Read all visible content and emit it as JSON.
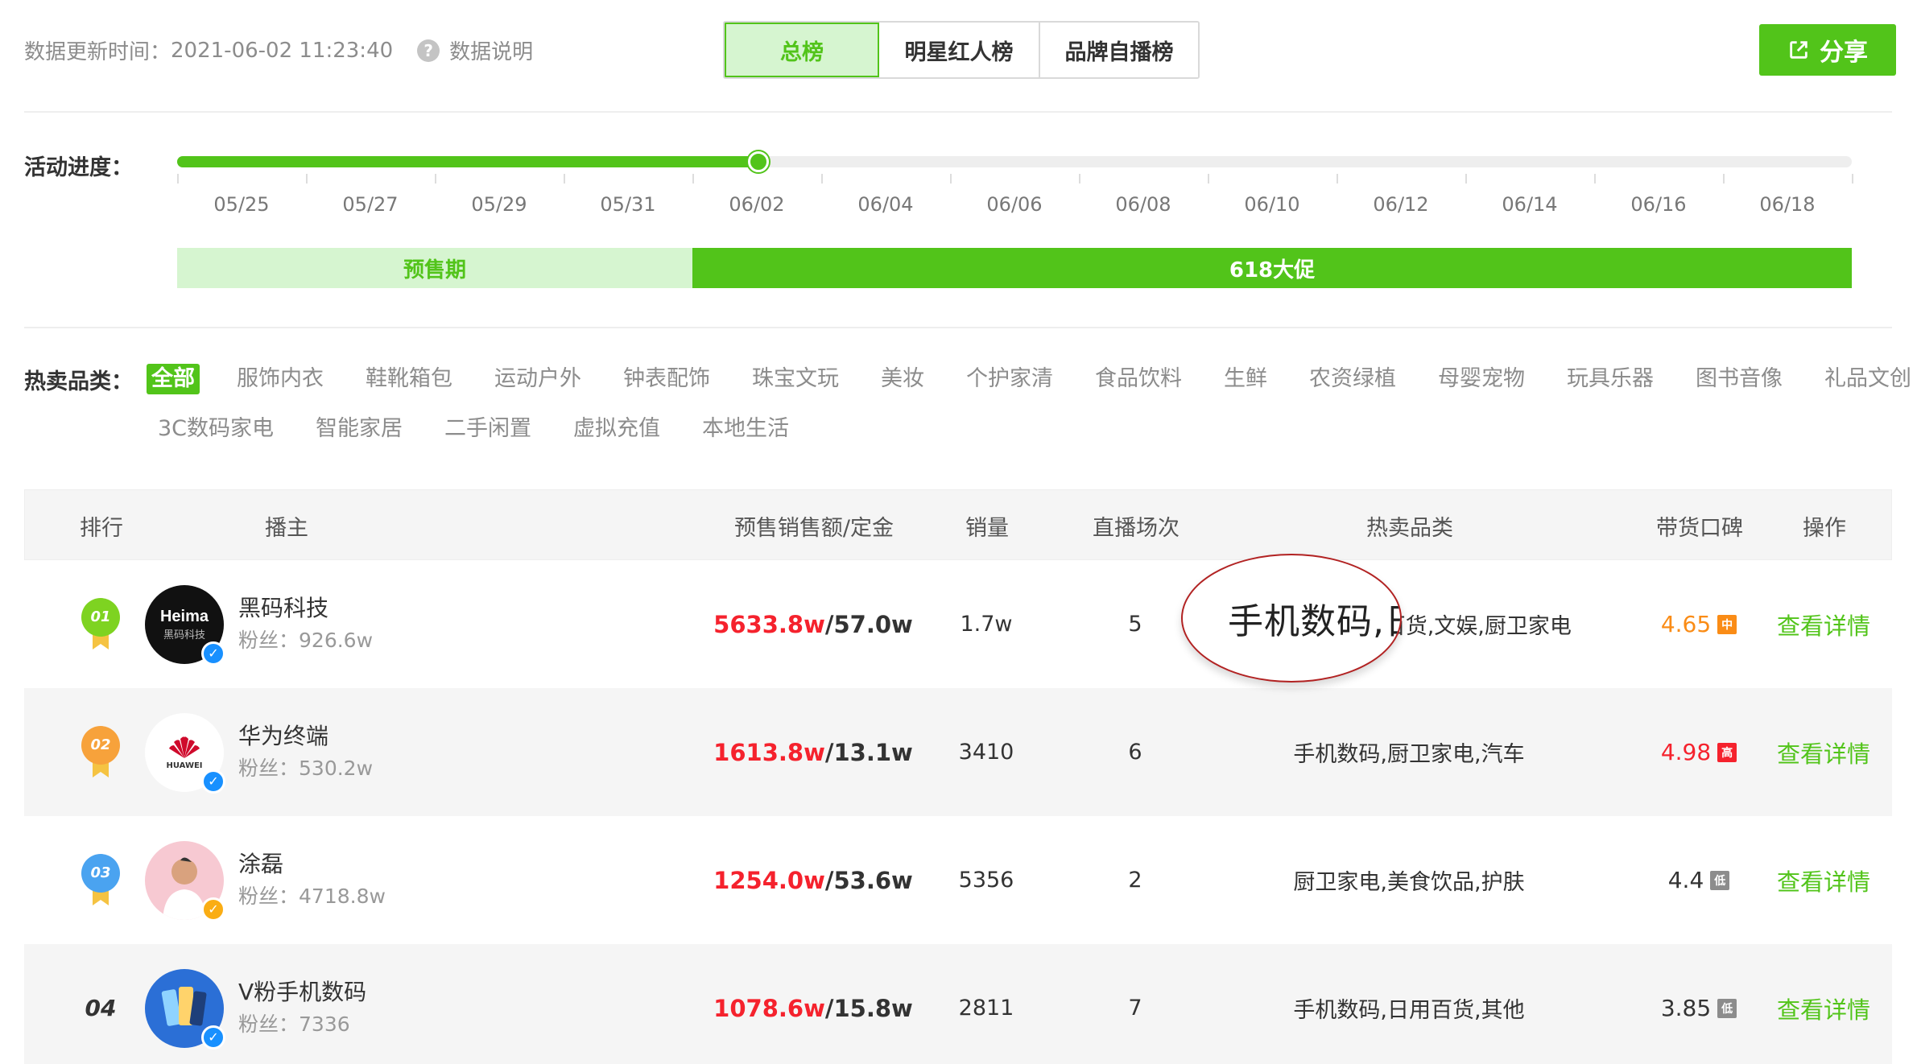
{
  "header": {
    "update_label": "数据更新时间：",
    "update_time": "2021-06-02 11:23:40",
    "help_text": "数据说明",
    "tabs": [
      {
        "label": "总榜",
        "active": true
      },
      {
        "label": "明星红人榜",
        "active": false
      },
      {
        "label": "品牌自播榜",
        "active": false
      }
    ],
    "share_label": "分享"
  },
  "progress": {
    "label": "活动进度：",
    "fraction": 0.347,
    "dates": [
      "05/25",
      "05/27",
      "05/29",
      "05/31",
      "06/02",
      "06/04",
      "06/06",
      "06/08",
      "06/10",
      "06/12",
      "06/14",
      "06/16",
      "06/18"
    ],
    "phase_presale": "预售期",
    "phase_main": "618大促"
  },
  "categories": {
    "label": "热卖品类：",
    "row1": [
      "全部",
      "服饰内衣",
      "鞋靴箱包",
      "运动户外",
      "钟表配饰",
      "珠宝文玩",
      "美妆",
      "个护家清",
      "食品饮料",
      "生鲜",
      "农资绿植",
      "母婴宠物",
      "玩具乐器",
      "图书音像",
      "礼品文创"
    ],
    "row2": [
      "3C数码家电",
      "智能家居",
      "二手闲置",
      "虚拟充值",
      "本地生活"
    ],
    "active": "全部"
  },
  "table": {
    "headers": {
      "rank": "排行",
      "anchor": "播主",
      "sales": "预售销售额/定金",
      "volume": "销量",
      "live": "直播场次",
      "category": "热卖品类",
      "reputation": "带货口碑",
      "op": "操作"
    },
    "fans_label": "粉丝：",
    "rows": [
      {
        "rank": "01",
        "name": "黑码科技",
        "fans": "926.6w",
        "sales": "5633.8w",
        "deposit": "/57.0w",
        "volume": "1.7w",
        "live": "5",
        "category": "手机数码,日用百货,文娱,厨卫家电",
        "score": "4.65",
        "badge": "中",
        "badge_color": "#fa8c16",
        "score_color": "#fa8c16",
        "avatar_text": "Heima",
        "avatar_sub": "黑码科技",
        "op": "查看详情"
      },
      {
        "rank": "02",
        "name": "华为终端",
        "fans": "530.2w",
        "sales": "1613.8w",
        "deposit": "/13.1w",
        "volume": "3410",
        "live": "6",
        "category": "手机数码,厨卫家电,汽车",
        "score": "4.98",
        "badge": "高",
        "badge_color": "#f5222d",
        "score_color": "#f5222d",
        "avatar_text": "HUAWEI",
        "avatar_sub": "",
        "op": "查看详情"
      },
      {
        "rank": "03",
        "name": "涂磊",
        "fans": "4718.8w",
        "sales": "1254.0w",
        "deposit": "/53.6w",
        "volume": "5356",
        "live": "2",
        "category": "厨卫家电,美食饮品,护肤",
        "score": "4.4",
        "badge": "低",
        "badge_color": "#8c8c8c",
        "score_color": "#333333",
        "avatar_text": "",
        "avatar_sub": "",
        "op": "查看详情"
      },
      {
        "rank": "04",
        "name": "V粉手机数码",
        "fans": "7336",
        "sales": "1078.6w",
        "deposit": "/15.8w",
        "volume": "2811",
        "live": "7",
        "category": "手机数码,日用百货,其他",
        "score": "3.85",
        "badge": "低",
        "badge_color": "#8c8c8c",
        "score_color": "#333333",
        "avatar_text": "",
        "avatar_sub": "",
        "op": "查看详情"
      }
    ]
  },
  "magnifier_text": "手机数码,日",
  "colors": {
    "accent": "#52c41a",
    "accent_light": "#d6f5d0",
    "sales_red": "#f5222d",
    "medal_gold": "#7ed321",
    "medal_orange": "#f7a23b",
    "medal_blue": "#4aa3f0",
    "verify_blue": "#1890ff",
    "verify_orange": "#faad14"
  }
}
